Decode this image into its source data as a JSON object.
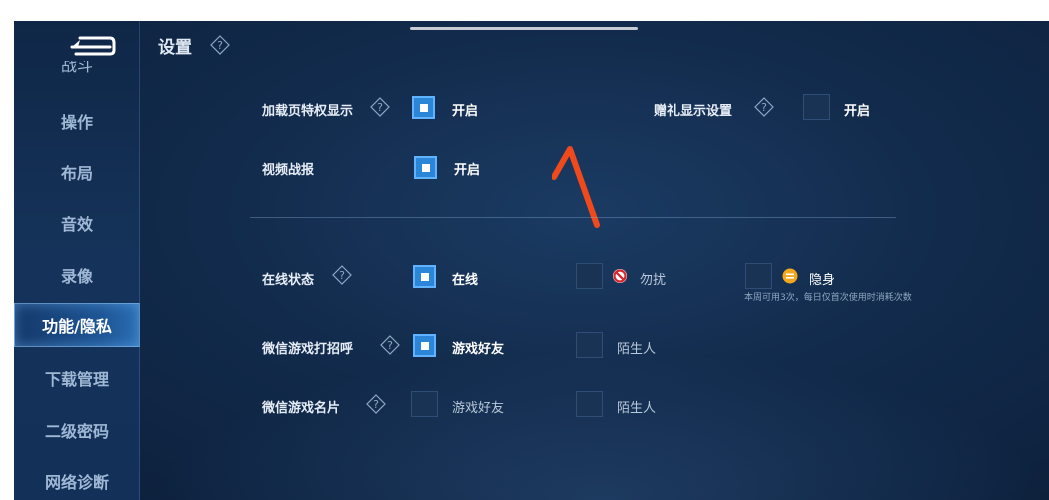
{
  "header": {
    "title": "设置"
  },
  "sidebar": {
    "partial_label": "战斗",
    "items": [
      {
        "label": "操作"
      },
      {
        "label": "布局"
      },
      {
        "label": "音效"
      },
      {
        "label": "录像"
      },
      {
        "label": "功能/隐私",
        "active": true
      },
      {
        "label": "下载管理"
      },
      {
        "label": "二级密码"
      },
      {
        "label": "网络诊断"
      }
    ]
  },
  "settings": {
    "loading_privilege": {
      "label": "加载页特权显示",
      "option": "开启",
      "checked": true
    },
    "gift_display": {
      "label": "赠礼显示设置",
      "option": "开启",
      "checked": false
    },
    "video_report": {
      "label": "视频战报",
      "option": "开启",
      "checked": true
    },
    "online_status": {
      "label": "在线状态",
      "options": [
        {
          "text": "在线",
          "checked": true
        },
        {
          "text": "勿扰",
          "checked": false,
          "icon": "no-disturb-icon"
        },
        {
          "text": "隐身",
          "checked": false,
          "icon": "invisible-icon"
        }
      ],
      "note": "本周可用3次，每日仅首次使用时消耗次数"
    },
    "wechat_greeting": {
      "label": "微信游戏打招呼",
      "options": [
        {
          "text": "游戏好友",
          "checked": true
        },
        {
          "text": "陌生人",
          "checked": false
        }
      ]
    },
    "wechat_card": {
      "label": "微信游戏名片",
      "options": [
        {
          "text": "游戏好友",
          "checked": false
        },
        {
          "text": "陌生人",
          "checked": false
        }
      ]
    }
  },
  "colors": {
    "accent": "#2b86d8",
    "background": "#122b4c",
    "annotation": "#f04a1c"
  }
}
